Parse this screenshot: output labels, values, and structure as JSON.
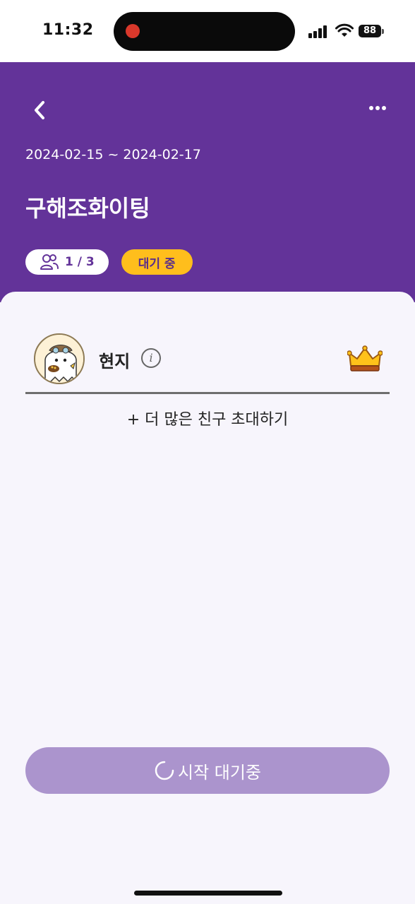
{
  "status_bar": {
    "time": "11:32",
    "battery": "88"
  },
  "header": {
    "date_range": "2024-02-15 ~ 2024-02-17",
    "title": "구해조화이팅",
    "member_count": "1 / 3",
    "status": "대기 중",
    "colors": {
      "background": "#633399",
      "status_badge": "#ffbe1c"
    }
  },
  "members": [
    {
      "name": "현지",
      "is_host": true,
      "avatar": "ghost-character"
    }
  ],
  "invite_label": "+ 더 많은 친구 초대하기",
  "start_button": {
    "label": "시작 대기중",
    "state": "loading"
  },
  "icons": [
    "back-chevron-icon",
    "more-icon",
    "people-icon",
    "info-icon",
    "crown-icon",
    "spinner-icon"
  ]
}
